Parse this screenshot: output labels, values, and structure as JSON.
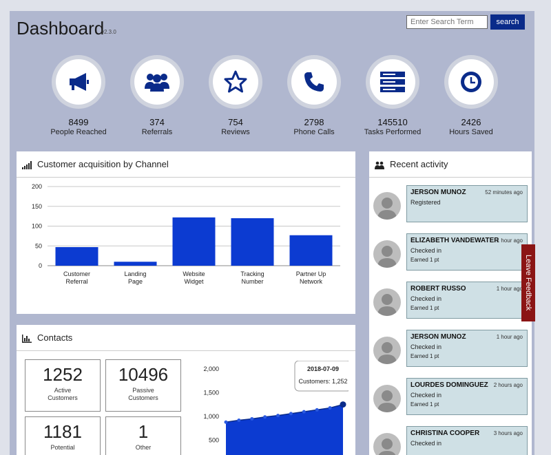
{
  "header": {
    "title": "Dashboard",
    "version": "v2.3.0"
  },
  "search": {
    "placeholder": "Enter Search Term",
    "button_label": "search"
  },
  "stats": [
    {
      "value": "8499",
      "label": "People Reached",
      "icon": "megaphone-icon"
    },
    {
      "value": "374",
      "label": "Referrals",
      "icon": "users-icon"
    },
    {
      "value": "754",
      "label": "Reviews",
      "icon": "star-icon"
    },
    {
      "value": "2798",
      "label": "Phone Calls",
      "icon": "phone-icon"
    },
    {
      "value": "145510",
      "label": "Tasks Performed",
      "icon": "server-icon"
    },
    {
      "value": "2426",
      "label": "Hours Saved",
      "icon": "clock-icon"
    }
  ],
  "acquisition": {
    "title": "Customer acquisition by Channel",
    "chart_data": {
      "type": "bar",
      "categories": [
        [
          "Customer",
          "Referral"
        ],
        [
          "Landing",
          "Page"
        ],
        [
          "Website",
          "Widget"
        ],
        [
          "Tracking",
          "Number"
        ],
        [
          "Partner Up",
          "Network"
        ]
      ],
      "values": [
        47,
        10,
        122,
        120,
        77
      ],
      "ylim": [
        0,
        200
      ],
      "yticks": [
        0,
        50,
        100,
        150,
        200
      ],
      "grid": true,
      "color": "#0c3bd1"
    }
  },
  "contacts": {
    "title": "Contacts",
    "kpis": [
      {
        "value": "1252",
        "label_line1": "Active",
        "label_line2": "Customers"
      },
      {
        "value": "10496",
        "label_line1": "Passive",
        "label_line2": "Customers"
      },
      {
        "value": "1181",
        "label_line1": "Potential",
        "label_line2": ""
      },
      {
        "value": "1",
        "label_line1": "Other",
        "label_line2": ""
      }
    ],
    "chart_data": {
      "type": "area",
      "yticks": [
        "2,000",
        "1,500",
        "1,000",
        "500"
      ],
      "ylim": [
        0,
        2000
      ],
      "values": [
        880,
        920,
        950,
        990,
        1020,
        1060,
        1100,
        1140,
        1180,
        1252
      ],
      "tooltip": {
        "date": "2018-07-09",
        "text": "Customers: 1,252"
      },
      "color": "#0c3bd1"
    }
  },
  "recent": {
    "title": "Recent activity",
    "items": [
      {
        "name": "JERSON MUNOZ",
        "time": "52 minutes ago",
        "status": "Registered",
        "points": ""
      },
      {
        "name": "ELIZABETH VANDEWATER",
        "time": "1 hour ago",
        "status": "Checked in",
        "points": "Earned 1 pt"
      },
      {
        "name": "ROBERT RUSSO",
        "time": "1 hour ago",
        "status": "Checked in",
        "points": "Earned 1 pt"
      },
      {
        "name": "JERSON MUNOZ",
        "time": "1 hour ago",
        "status": "Checked in",
        "points": "Earned 1 pt"
      },
      {
        "name": "LOURDES DOMINGUEZ",
        "time": "2 hours ago",
        "status": "Checked in",
        "points": "Earned 1 pt"
      },
      {
        "name": "CHRISTINA COOPER",
        "time": "3 hours ago",
        "status": "Checked in",
        "points": ""
      }
    ]
  },
  "feedback": {
    "label": "Leave Feedback"
  }
}
